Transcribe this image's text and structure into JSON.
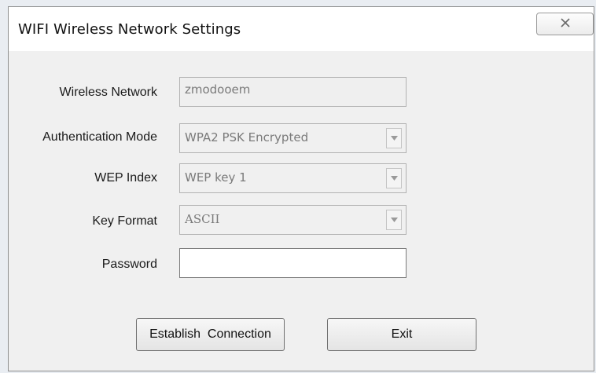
{
  "window": {
    "title": "WIFI Wireless Network Settings",
    "close_glyph": "⌧"
  },
  "form": {
    "wireless_network": {
      "label": "Wireless Network",
      "value": "zmodooem"
    },
    "authentication_mode": {
      "label": "Authentication Mode",
      "value": "WPA2 PSK Encrypted"
    },
    "wep_index": {
      "label": "WEP Index",
      "value": "WEP key 1"
    },
    "key_format": {
      "label": "Key Format",
      "value": "ASCII"
    },
    "password": {
      "label": "Password",
      "value": ""
    }
  },
  "buttons": {
    "establish": "Establish  Connection",
    "exit": "Exit"
  }
}
